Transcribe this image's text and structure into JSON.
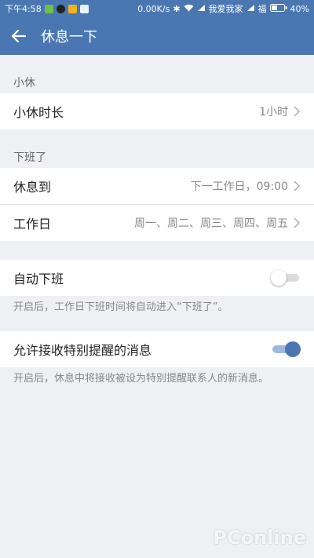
{
  "status_bar": {
    "time": "下午4:58",
    "speed": "0.00K/s",
    "carrier1": "我爱我家",
    "carrier2": "福",
    "battery": "40%"
  },
  "app_bar": {
    "title": "休息一下"
  },
  "sections": {
    "short_break": {
      "header": "小休",
      "duration_label": "小休时长",
      "duration_value": "1小时"
    },
    "off_work": {
      "header": "下班了",
      "rest_until_label": "休息到",
      "rest_until_value": "下一工作日，09:00",
      "workdays_label": "工作日",
      "workdays_value": "周一、周二、周三、周四、周五"
    },
    "auto_off": {
      "label": "自动下班",
      "enabled": false,
      "note": "开启后，工作日下班时间将自动进入“下班了”。"
    },
    "special_reminder": {
      "label": "允许接收特别提醒的消息",
      "enabled": true,
      "note": "开启后，休息中将接收被设为特别提醒联系人的新消息。"
    }
  },
  "colors": {
    "accent": "#4a77b1",
    "background": "#eff0f4"
  },
  "watermark": {
    "text": "PConline"
  }
}
